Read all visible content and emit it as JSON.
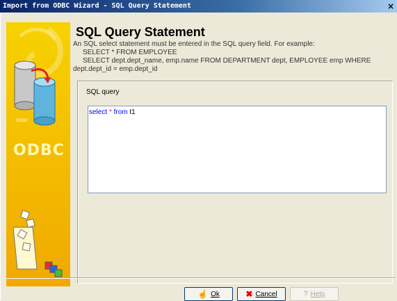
{
  "window": {
    "title": "Import from ODBC Wizard - SQL Query Statement",
    "close_glyph": "×"
  },
  "left_panel": {
    "logo_text": "ODBC",
    "db_label": "ODBC"
  },
  "header": {
    "title": "SQL Query Statement",
    "description_line1": "An SQL select statement must be entered in the SQL query field. For example:",
    "example1": "SELECT * FROM EMPLOYEE",
    "example2": "SELECT dept.dept_name, emp.name FROM DEPARTMENT dept, EMPLOYEE emp WHERE",
    "example2_cont": "dept.dept_id = emp.dept_id"
  },
  "query": {
    "label": "SQL query",
    "text_kw1": "select",
    "text_star": "*",
    "text_kw2": "from",
    "text_table": "t1"
  },
  "buttons": {
    "ok": "Ok",
    "cancel": "Cancel",
    "help": "Help"
  },
  "colors": {
    "accent": "#0a246a",
    "keyword": "#0000ff",
    "panel_yellow": "#f3c400"
  }
}
